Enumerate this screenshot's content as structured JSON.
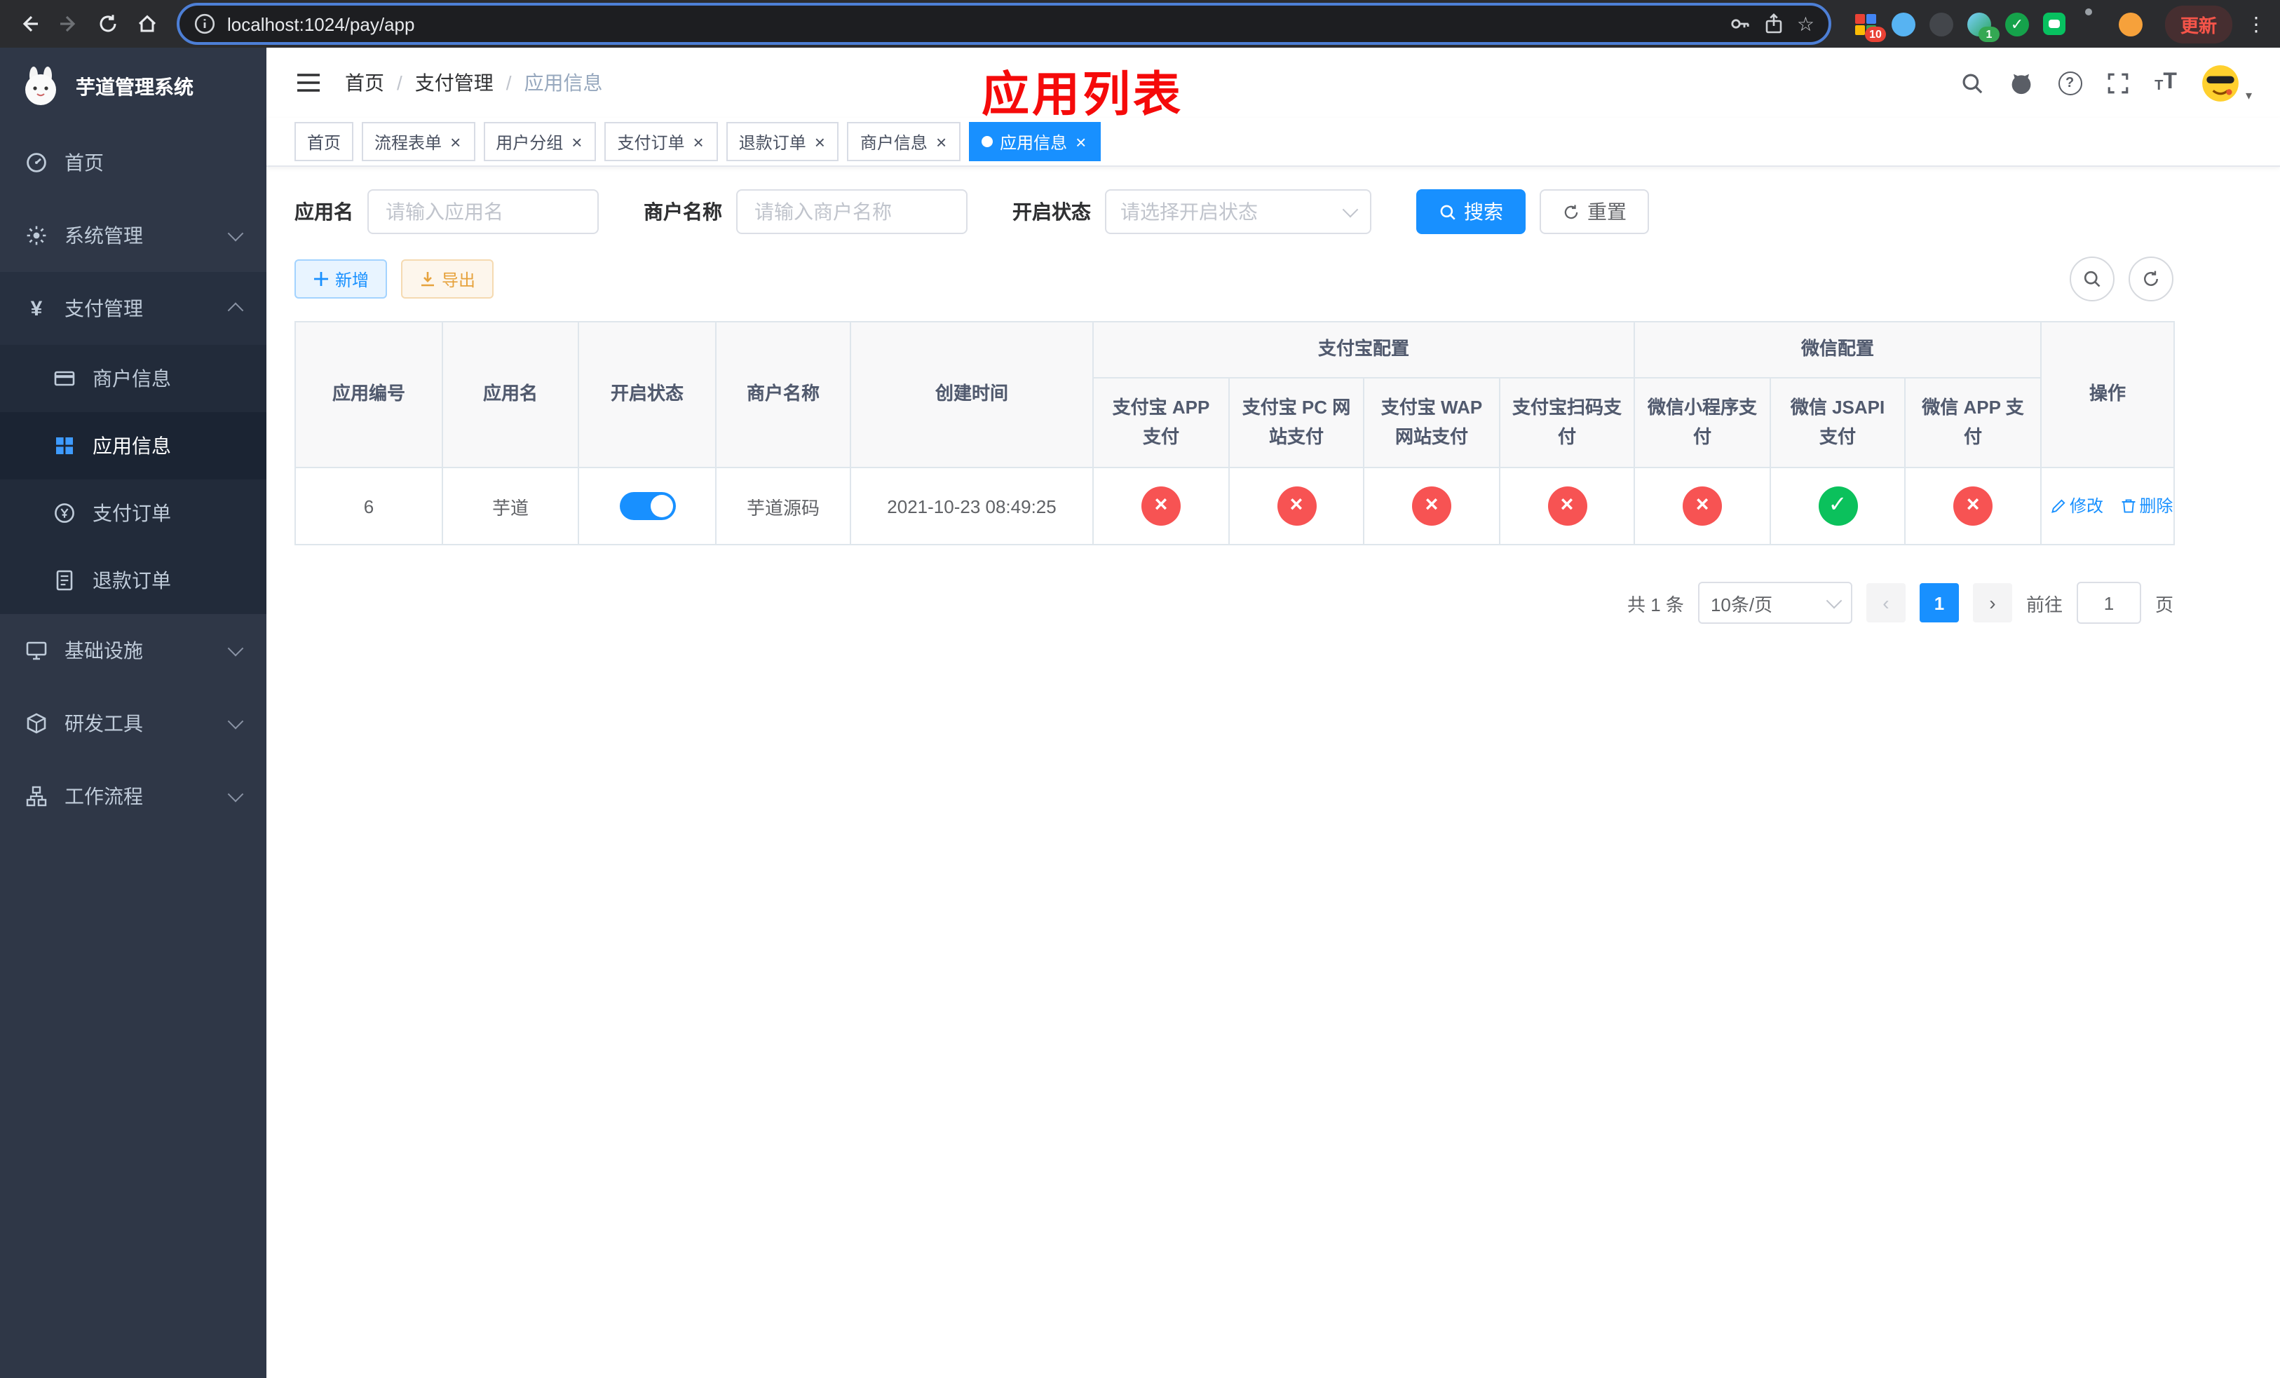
{
  "colors": {
    "accent": "#1890ff",
    "success": "#0bc15c",
    "danger": "#f75353",
    "warning": "#e6a23c",
    "annotation": "#f50a0a",
    "sidebar_bg": "#2f3747"
  },
  "browser": {
    "url": "localhost:1024/pay/app",
    "update_button": "更新",
    "ext_badge_count": "10",
    "profile_badge_count": "1"
  },
  "annotation": {
    "title": "应用列表"
  },
  "sidebar": {
    "logo_title": "芋道管理系统",
    "menu": [
      {
        "label": "首页"
      },
      {
        "label": "系统管理"
      },
      {
        "label": "支付管理"
      },
      {
        "label": "基础设施"
      },
      {
        "label": "研发工具"
      },
      {
        "label": "工作流程"
      }
    ],
    "submenu": [
      {
        "label": "商户信息"
      },
      {
        "label": "应用信息"
      },
      {
        "label": "支付订单"
      },
      {
        "label": "退款订单"
      }
    ]
  },
  "breadcrumb": {
    "items": [
      "首页",
      "支付管理",
      "应用信息"
    ]
  },
  "tabs": [
    {
      "label": "首页",
      "closable": false,
      "active": false
    },
    {
      "label": "流程表单",
      "closable": true,
      "active": false
    },
    {
      "label": "用户分组",
      "closable": true,
      "active": false
    },
    {
      "label": "支付订单",
      "closable": true,
      "active": false
    },
    {
      "label": "退款订单",
      "closable": true,
      "active": false
    },
    {
      "label": "商户信息",
      "closable": true,
      "active": false
    },
    {
      "label": "应用信息",
      "closable": true,
      "active": true
    }
  ],
  "filters": {
    "app_name_label": "应用名",
    "app_name_placeholder": "请输入应用名",
    "merchant_label": "商户名称",
    "merchant_placeholder": "请输入商户名称",
    "status_label": "开启状态",
    "status_placeholder": "请选择开启状态",
    "search_button": "搜索",
    "reset_button": "重置"
  },
  "toolbar": {
    "add_button": "新增",
    "export_button": "导出"
  },
  "table": {
    "group_headers": {
      "alipay": "支付宝配置",
      "wechat": "微信配置"
    },
    "columns": [
      "应用编号",
      "应用名",
      "开启状态",
      "商户名称",
      "创建时间",
      "支付宝 APP 支付",
      "支付宝 PC 网站支付",
      "支付宝 WAP 网站支付",
      "支付宝扫码支付",
      "微信小程序支付",
      "微信 JSAPI 支付",
      "微信 APP 支付",
      "操作"
    ],
    "row": {
      "id": "6",
      "name": "芋道",
      "status_on": true,
      "merchant": "芋道源码",
      "created_at": "2021-10-23 08:49:25",
      "pay_channels": [
        "off",
        "off",
        "off",
        "off",
        "off",
        "on",
        "off"
      ],
      "edit_label": "修改",
      "delete_label": "删除"
    }
  },
  "pagination": {
    "total_text": "共 1 条",
    "page_size": "10条/页",
    "current_page": "1",
    "goto_prefix": "前往",
    "goto_value": "1",
    "goto_suffix": "页"
  }
}
